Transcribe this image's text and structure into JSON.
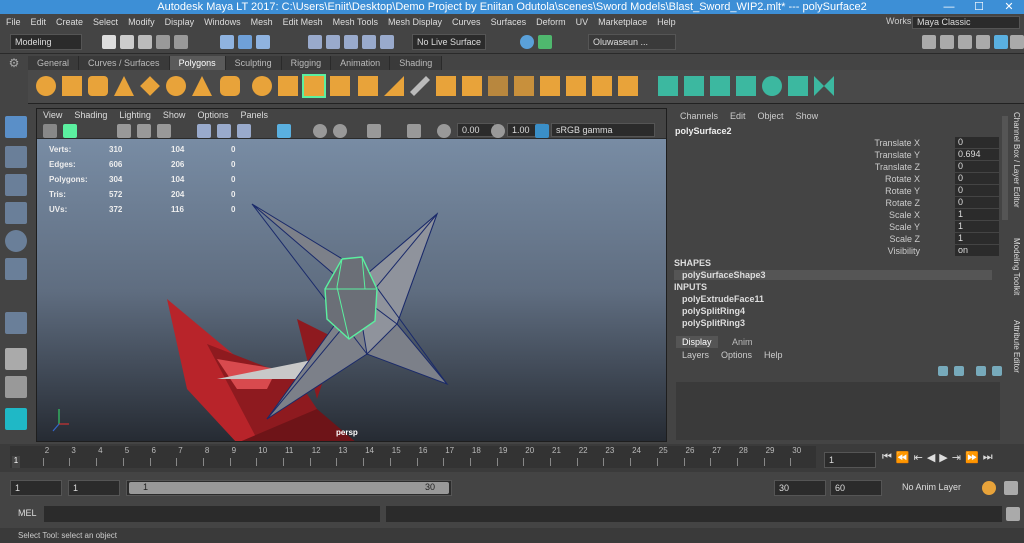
{
  "window": {
    "title": "Autodesk Maya LT 2017: C:\\Users\\Eniit\\Desktop\\Demo Project by Eniitan Odutola\\scenes\\Sword Models\\Blast_Sword_WIP2.mlt*   ---   polySurface2",
    "minimize": "—",
    "maximize": "☐",
    "close": "✕"
  },
  "menubar": {
    "items": [
      "File",
      "Edit",
      "Create",
      "Select",
      "Modify",
      "Display",
      "Windows",
      "Mesh",
      "Edit Mesh",
      "Mesh Tools",
      "Mesh Display",
      "Curves",
      "Surfaces",
      "Deform",
      "UV",
      "Marketplace",
      "Help"
    ],
    "workspace_label": "Workspace :",
    "workspace_value": "Maya Classic"
  },
  "statusline": {
    "mode": "Modeling",
    "live_surface": "No Live Surface",
    "user": "Oluwaseun ..."
  },
  "shelf": {
    "tabs": [
      "General",
      "Curves / Surfaces",
      "Polygons",
      "Sculpting",
      "Rigging",
      "Animation",
      "Shading"
    ],
    "active": "Polygons"
  },
  "viewport": {
    "menus": [
      "View",
      "Shading",
      "Lighting",
      "Show",
      "Options",
      "Panels"
    ],
    "exposure": "0.00",
    "gamma": "1.00",
    "colorspace": "sRGB gamma",
    "camera": "persp",
    "hud": [
      {
        "label": "Verts:",
        "a": "310",
        "b": "104",
        "c": "0"
      },
      {
        "label": "Edges:",
        "a": "606",
        "b": "206",
        "c": "0"
      },
      {
        "label": "Polygons:",
        "a": "304",
        "b": "104",
        "c": "0"
      },
      {
        "label": "Tris:",
        "a": "572",
        "b": "204",
        "c": "0"
      },
      {
        "label": "UVs:",
        "a": "372",
        "b": "116",
        "c": "0"
      }
    ]
  },
  "channelbox": {
    "menus": [
      "Channels",
      "Edit",
      "Object",
      "Show"
    ],
    "object": "polySurface2",
    "channels": [
      {
        "label": "Translate X",
        "value": "0"
      },
      {
        "label": "Translate Y",
        "value": "0.694"
      },
      {
        "label": "Translate Z",
        "value": "0"
      },
      {
        "label": "Rotate X",
        "value": "0"
      },
      {
        "label": "Rotate Y",
        "value": "0"
      },
      {
        "label": "Rotate Z",
        "value": "0"
      },
      {
        "label": "Scale X",
        "value": "1"
      },
      {
        "label": "Scale Y",
        "value": "1"
      },
      {
        "label": "Scale Z",
        "value": "1"
      },
      {
        "label": "Visibility",
        "value": "on"
      }
    ],
    "shapes_header": "SHAPES",
    "shape_node": "polySurfaceShape3",
    "inputs_header": "INPUTS",
    "inputs": [
      "polyExtrudeFace11",
      "polySplitRing4",
      "polySplitRing3"
    ]
  },
  "layereditor": {
    "tabs": [
      "Display",
      "Anim"
    ],
    "menus": [
      "Layers",
      "Options",
      "Help"
    ]
  },
  "sidetabs": [
    "Channel Box / Layer Editor",
    "Modeling Toolkit",
    "Attribute Editor"
  ],
  "timeslider": {
    "ticks": [
      "1",
      "2",
      "3",
      "4",
      "5",
      "6",
      "7",
      "8",
      "9",
      "10",
      "11",
      "12",
      "13",
      "14",
      "15",
      "16",
      "17",
      "18",
      "19",
      "20",
      "21",
      "22",
      "23",
      "24",
      "25",
      "26",
      "27",
      "28",
      "29",
      "30"
    ],
    "current": "1",
    "current_field": "1"
  },
  "range": {
    "start": "1",
    "start2": "1",
    "slider_start": "1",
    "slider_end": "30",
    "end": "30",
    "end2": "60",
    "anim_layer": "No Anim Layer"
  },
  "mel": {
    "label": "MEL"
  },
  "help": {
    "text": "Select Tool: select an object"
  },
  "colors": {
    "accent": "#3d8fd6",
    "shelf_icon": "#e8a33a",
    "selection": "#5bf0a0",
    "sword_red": "#b8242a"
  }
}
